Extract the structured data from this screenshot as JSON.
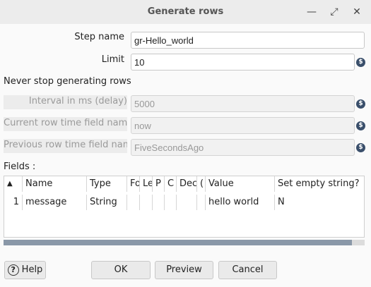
{
  "window": {
    "title": "Generate rows",
    "min_glyph": "—",
    "max_glyph": "⤢",
    "close_glyph": "✕"
  },
  "form": {
    "step_name_label": "Step name",
    "step_name_value": "gr-Hello_world",
    "limit_label": "Limit",
    "limit_value": "10",
    "never_stop_label": "Never stop generating rows",
    "interval_label": "Interval in ms (delay)",
    "interval_value": "5000",
    "current_row_label": "Current row time field name",
    "current_row_value": "now",
    "previous_row_label": "Previous row time field name",
    "previous_row_value": "FiveSecondsAgo",
    "variable_icon_glyph": "$"
  },
  "fields": {
    "label": "Fields :",
    "columns": [
      "#",
      "Name",
      "Type",
      "Format",
      "Length",
      "Precision",
      "Currency",
      "Decimal",
      "Group",
      "Value",
      "Set empty string?"
    ],
    "columns_visible": [
      "",
      "Name",
      "Type",
      "Fo",
      "Le",
      "P",
      "C",
      "Dec",
      "(",
      "Value",
      "Set empty string?"
    ],
    "rows": [
      {
        "num": "1",
        "name": "message",
        "type": "String",
        "format": "",
        "length": "",
        "precision": "",
        "currency": "",
        "decimal": "",
        "group": "",
        "value": "hello world",
        "empty": "N"
      }
    ]
  },
  "buttons": {
    "help": "Help",
    "help_icon": "?",
    "ok": "OK",
    "preview": "Preview",
    "cancel": "Cancel"
  }
}
